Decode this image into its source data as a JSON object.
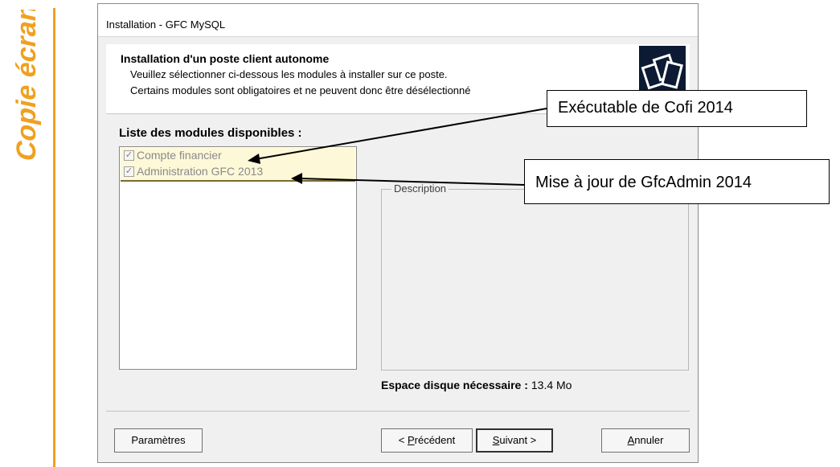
{
  "side_label": "Copie écran",
  "dialog": {
    "title": "Installation - GFC MySQL",
    "header": {
      "title": "Installation d'un poste client autonome",
      "line1": "Veuillez sélectionner ci-dessous les modules à installer sur ce poste.",
      "line2": "Certains modules sont obligatoires et ne peuvent donc être désélectionné"
    },
    "modules_title": "Liste des modules disponibles :",
    "modules": [
      {
        "label": "Compte financier",
        "checked": true,
        "disabled": true
      },
      {
        "label": "Administration GFC 2013",
        "checked": true,
        "disabled": true
      }
    ],
    "description_label": "Description",
    "disk_label": "Espace disque nécessaire :",
    "disk_value": "13.4 Mo",
    "buttons": {
      "params": "Paramètres",
      "prev_prefix": "< ",
      "prev_ul": "P",
      "prev_rest": "récédent",
      "next_ul": "S",
      "next_rest": "uivant >",
      "cancel_ul": "A",
      "cancel_rest": "nnuler"
    }
  },
  "callouts": {
    "cofi": "Exécutable de Cofi 2014",
    "gfc": "Mise à jour de GfcAdmin 2014"
  },
  "colors": {
    "accent_orange": "#f0a020",
    "module_highlight": "#fdf8d8"
  }
}
